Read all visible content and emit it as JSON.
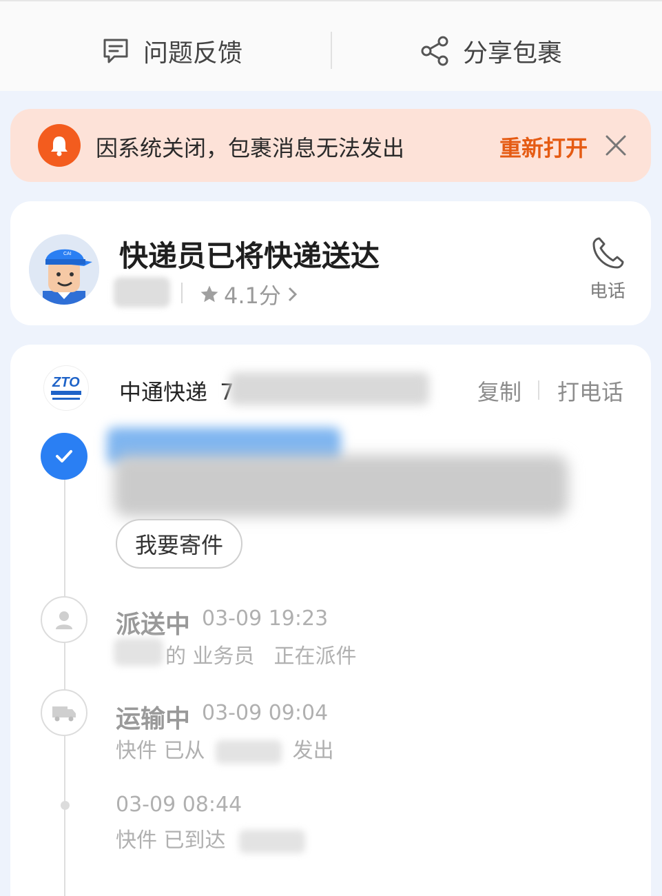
{
  "topbar": {
    "feedback_label": "问题反馈",
    "share_label": "分享包裹"
  },
  "notice": {
    "message": "因系统关闭，包裹消息无法发出",
    "reopen_label": "重新打开"
  },
  "courier": {
    "title": "快递员已将快递送达",
    "rating": "4.1分",
    "phone_label": "电话"
  },
  "tracking": {
    "carrier_name": "中通快递",
    "tracking_visible_prefix": "7",
    "copy_label": "复制",
    "call_label": "打电话",
    "send_button_label": "我要寄件",
    "events": [
      {
        "title": "派送中",
        "time": "03-09  19:23",
        "desc_a": "的  业务员",
        "desc_b": "正在派件",
        "icon": "person-icon"
      },
      {
        "title": "运输中",
        "time": "03-09  09:04",
        "desc_a": "快件 已从",
        "desc_b": "发出",
        "icon": "truck-icon"
      },
      {
        "title": "",
        "time": "03-09  08:44",
        "desc_a": "快件 已到达",
        "desc_b": "",
        "icon": "dot"
      }
    ]
  },
  "colors": {
    "accent_orange": "#e55b13",
    "bell_orange": "#f35c1e",
    "check_blue": "#2a7ff3",
    "notice_bg": "#fde2d8"
  }
}
